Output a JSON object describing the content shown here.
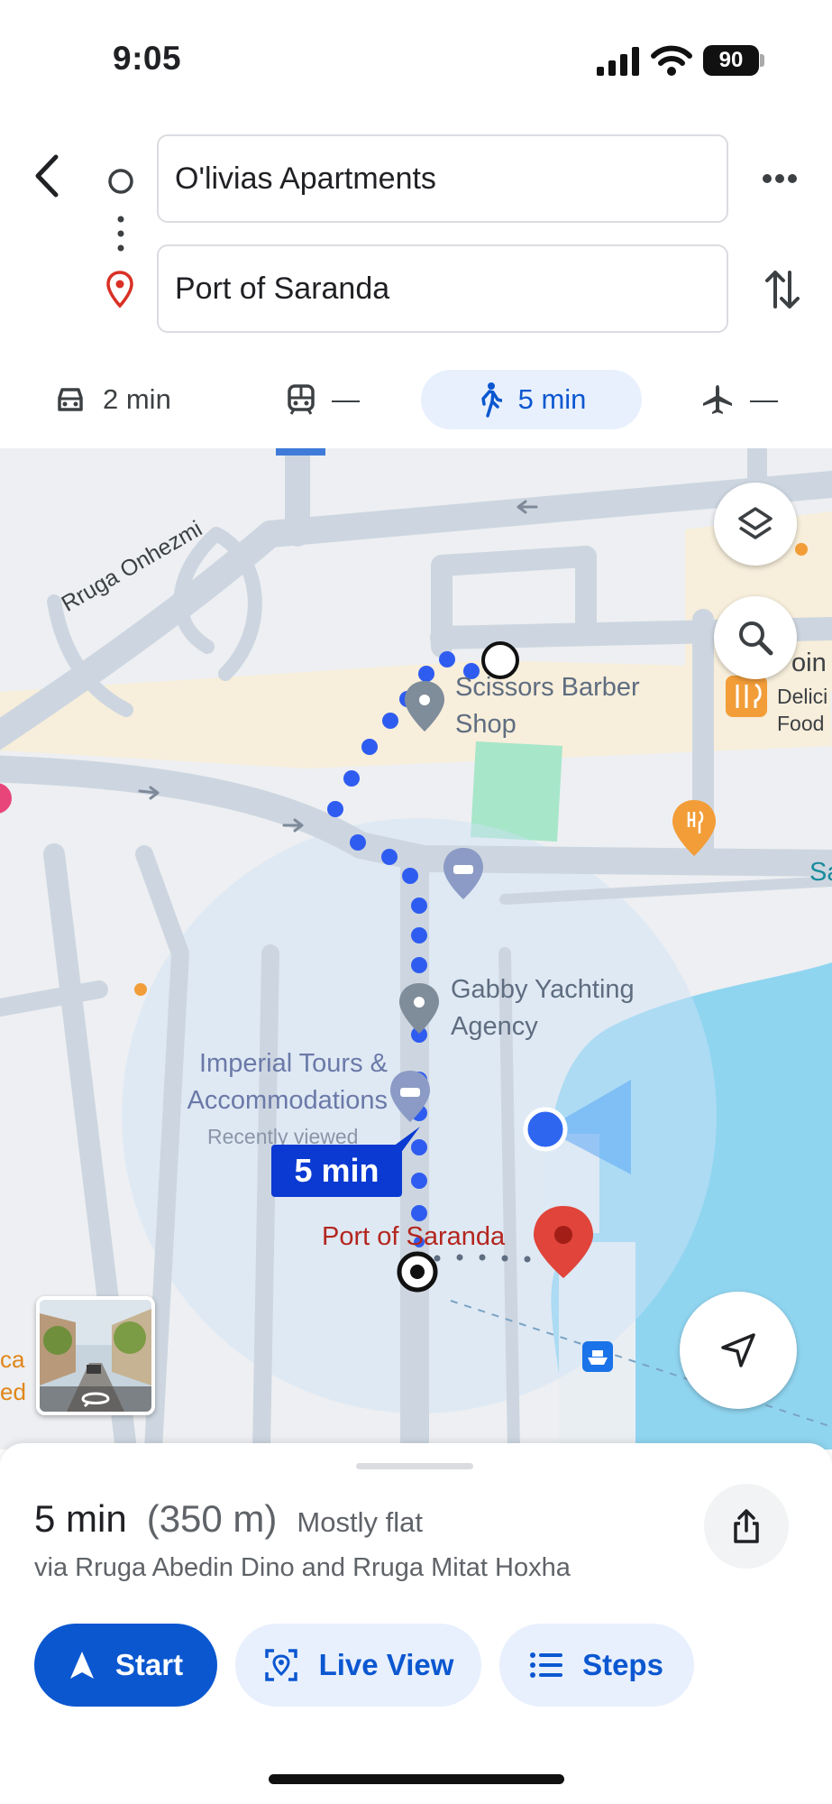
{
  "status": {
    "time": "9:05",
    "battery": "90"
  },
  "route": {
    "origin": "O'livias Apartments",
    "destination": "Port of Saranda"
  },
  "modes": [
    {
      "icon": "car-icon",
      "label": "2 min"
    },
    {
      "icon": "transit-icon",
      "label": "—"
    },
    {
      "icon": "walk-icon",
      "label": "5 min",
      "selected": true
    },
    {
      "icon": "airplane-icon",
      "label": "—"
    }
  ],
  "map": {
    "street_label": "Rruga Onhezmi",
    "pois": {
      "barber": "Scissors Barber Shop",
      "yachting": "Gabby Yachting Agency",
      "tours": "Imperial Tours & Accommodations",
      "tours_sub": "Recently viewed",
      "port": "Port of Saranda",
      "food_partial_1": "oin",
      "food_partial_2": "Delici",
      "food_partial_3": "Food",
      "edge_right": "Sa",
      "edge_left_1": "ca",
      "edge_left_2": "ed"
    },
    "route_time": "5 min",
    "colors": {
      "route": "#2f5cf0",
      "water": "#90d5f0",
      "destination_pin": "#d93025"
    }
  },
  "summary": {
    "duration": "5 min",
    "distance": "(350 m)",
    "terrain": "Mostly flat",
    "via": "via Rruga Abedin Dino and Rruga Mitat Hoxha"
  },
  "actions": {
    "start": "Start",
    "live_view": "Live View",
    "steps": "Steps"
  }
}
